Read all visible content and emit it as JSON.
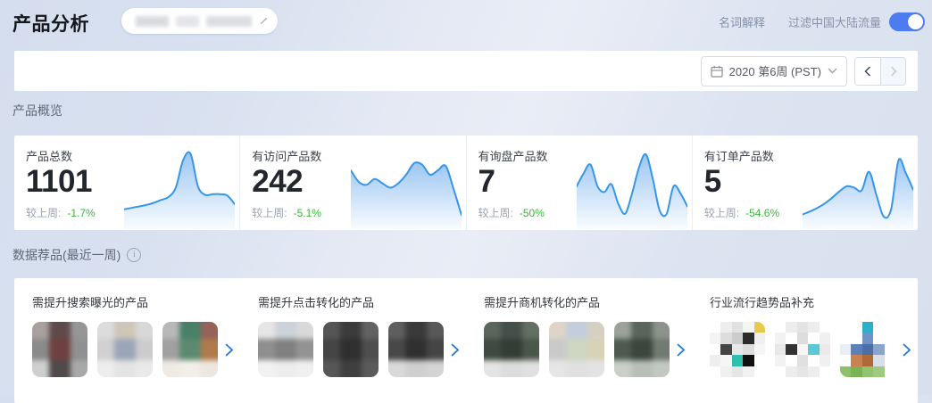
{
  "header": {
    "title": "产品分析",
    "glossary_link": "名词解释",
    "filter_label": "过滤中国大陆流量",
    "filter_on": true,
    "toggle_color": "#4d7bf0"
  },
  "toolbar": {
    "week_label": "2020 第6周 (PST)"
  },
  "overview": {
    "section_title": "产品概览",
    "colors": {
      "spark_stroke": "#3696ea",
      "spark_fill": "#4997e8",
      "change_green": "#3cb53c"
    },
    "cards": [
      {
        "label": "产品总数",
        "value": "1101",
        "compare_label": "较上周:",
        "change": "-1.7%",
        "spark": [
          20,
          22,
          24,
          26,
          29,
          33,
          37,
          50,
          88,
          97,
          52,
          40,
          41,
          41,
          39,
          27
        ]
      },
      {
        "label": "有访问产品数",
        "value": "242",
        "compare_label": "较上周:",
        "change": "-5.1%",
        "spark": [
          74,
          58,
          54,
          62,
          56,
          50,
          56,
          68,
          84,
          82,
          68,
          74,
          80,
          48,
          12
        ]
      },
      {
        "label": "有询盘产品数",
        "value": "7",
        "compare_label": "较上周:",
        "change": "-50%",
        "spark": [
          52,
          70,
          82,
          52,
          44,
          55,
          28,
          14,
          42,
          78,
          96,
          62,
          18,
          14,
          52,
          42,
          24
        ]
      },
      {
        "label": "有订单产品数",
        "value": "5",
        "compare_label": "较上周:",
        "change": "-54.6%",
        "spark": [
          13,
          17,
          22,
          28,
          36,
          45,
          52,
          50,
          46,
          72,
          40,
          10,
          20,
          88,
          70,
          47
        ]
      }
    ]
  },
  "recommendations": {
    "section_title": "数据荐品(最近一周)",
    "info_glyph": "i",
    "columns": [
      {
        "title": "需提升搜索曝光的产品",
        "thumbs": [
          {
            "grid": 3,
            "blur": true,
            "colors": [
              "#a99f9f",
              "#5f4a4a",
              "#969696",
              "#8b8b8b",
              "#6f4040",
              "#909090",
              "#cfcfcf",
              "#514a4a",
              "#a8a8a8"
            ]
          },
          {
            "grid": 3,
            "blur": true,
            "colors": [
              "#dcdcdc",
              "#cfc6b8",
              "#d8d8d8",
              "#d0d0d0",
              "#9aa6b8",
              "#cccccc",
              "#ededed",
              "#e4e4e4",
              "#e9e9e9"
            ]
          },
          {
            "grid": 3,
            "blur": true,
            "colors": [
              "#b8b8b8",
              "#48806a",
              "#96625a",
              "#a0a0a0",
              "#5c8a70",
              "#b07a4a",
              "#efeae4",
              "#f3eee8",
              "#ede7e1"
            ]
          }
        ]
      },
      {
        "title": "需提升点击转化的产品",
        "thumbs": [
          {
            "grid": 3,
            "blur": true,
            "colors": [
              "#e6e6e6",
              "#ccd2da",
              "#d9d9d9",
              "#8f8f8f",
              "#808080",
              "#939393",
              "#f2f2f2",
              "#ededed",
              "#f0f0f0"
            ]
          },
          {
            "grid": 3,
            "blur": true,
            "colors": [
              "#555555",
              "#3b3b3b",
              "#636363",
              "#444444",
              "#2f2f2f",
              "#4e4e4e",
              "#565656",
              "#3f3f3f",
              "#5a5a5a"
            ]
          },
          {
            "grid": 3,
            "blur": true,
            "colors": [
              "#5e5e5e",
              "#3a3a3a",
              "#585858",
              "#484848",
              "#303030",
              "#454545",
              "#d9d9d9",
              "#cfcfcf",
              "#d4d4d4"
            ]
          }
        ]
      },
      {
        "title": "需提升商机转化的产品",
        "thumbs": [
          {
            "grid": 3,
            "blur": true,
            "colors": [
              "#5a665c",
              "#44504a",
              "#636f63",
              "#3e4a42",
              "#333d36",
              "#4a564c",
              "#e4e4e4",
              "#dcdcdc",
              "#e0e0e0"
            ]
          },
          {
            "grid": 3,
            "blur": true,
            "colors": [
              "#ded5c6",
              "#c2cedd",
              "#d6d0c2",
              "#c9c9c9",
              "#cfd6c2",
              "#d8d2b8",
              "#e6e6e6",
              "#e0e0e0",
              "#e3e3e3"
            ]
          },
          {
            "grid": 3,
            "blur": true,
            "colors": [
              "#9aa29a",
              "#59655c",
              "#8b938b",
              "#4e5a50",
              "#3a463e",
              "#707a70",
              "#c9cfc9",
              "#b8beb8",
              "#c2c8c2"
            ]
          }
        ]
      },
      {
        "title": "行业流行趋势品补充",
        "thumbs": [
          {
            "grid": 5,
            "blur": false,
            "colors": [
              "#ffffff",
              "#eeeeee",
              "#e2e2e2",
              "#f5f5f5",
              "#e8c94a",
              "#f4f4f4",
              "#dddddd",
              "#cccccc",
              "#2b2b2b",
              "#f0f0f0",
              "#ffffff",
              "#444444",
              "#e8e8e8",
              "#dddddd",
              "#f6f6f6",
              "#eeeeee",
              "#f6f6f6",
              "#2fbfae",
              "#111111",
              "#ffffff",
              "#ffffff",
              "#f0f0f0",
              "#e6e6e6",
              "#f2f2f2",
              "#ffffff"
            ]
          },
          {
            "grid": 5,
            "blur": false,
            "colors": [
              "#ffffff",
              "#ededed",
              "#e4e4e4",
              "#ededed",
              "#ffffff",
              "#f2f2f2",
              "#ffffff",
              "#dddddd",
              "#ffffff",
              "#f0f0f0",
              "#e8e8e8",
              "#333333",
              "#f6f6f6",
              "#5bc8d8",
              "#ebebeb",
              "#f2f2f2",
              "#ffffff",
              "#e0e0e0",
              "#ffffff",
              "#f0f0f0",
              "#ffffff",
              "#ededed",
              "#e6e6e6",
              "#ededed",
              "#ffffff"
            ]
          },
          {
            "grid": 5,
            "blur": false,
            "colors": [
              "#ffffff",
              "#ffffff",
              "#2ab0c8",
              "#ffffff",
              "#ffffff",
              "#ffffff",
              "#ffffff",
              "#6f93c4",
              "#ffffff",
              "#ffffff",
              "#e8eef6",
              "#5c80b8",
              "#4a6ea8",
              "#8aa4cc",
              "#ffffff",
              "#ffffff",
              "#c8834e",
              "#b06a3a",
              "#d8dfe8",
              "#ffffff",
              "#8ec06a",
              "#7ab254",
              "#90c46e",
              "#a0ca80",
              "#ffffff"
            ]
          }
        ]
      }
    ]
  }
}
